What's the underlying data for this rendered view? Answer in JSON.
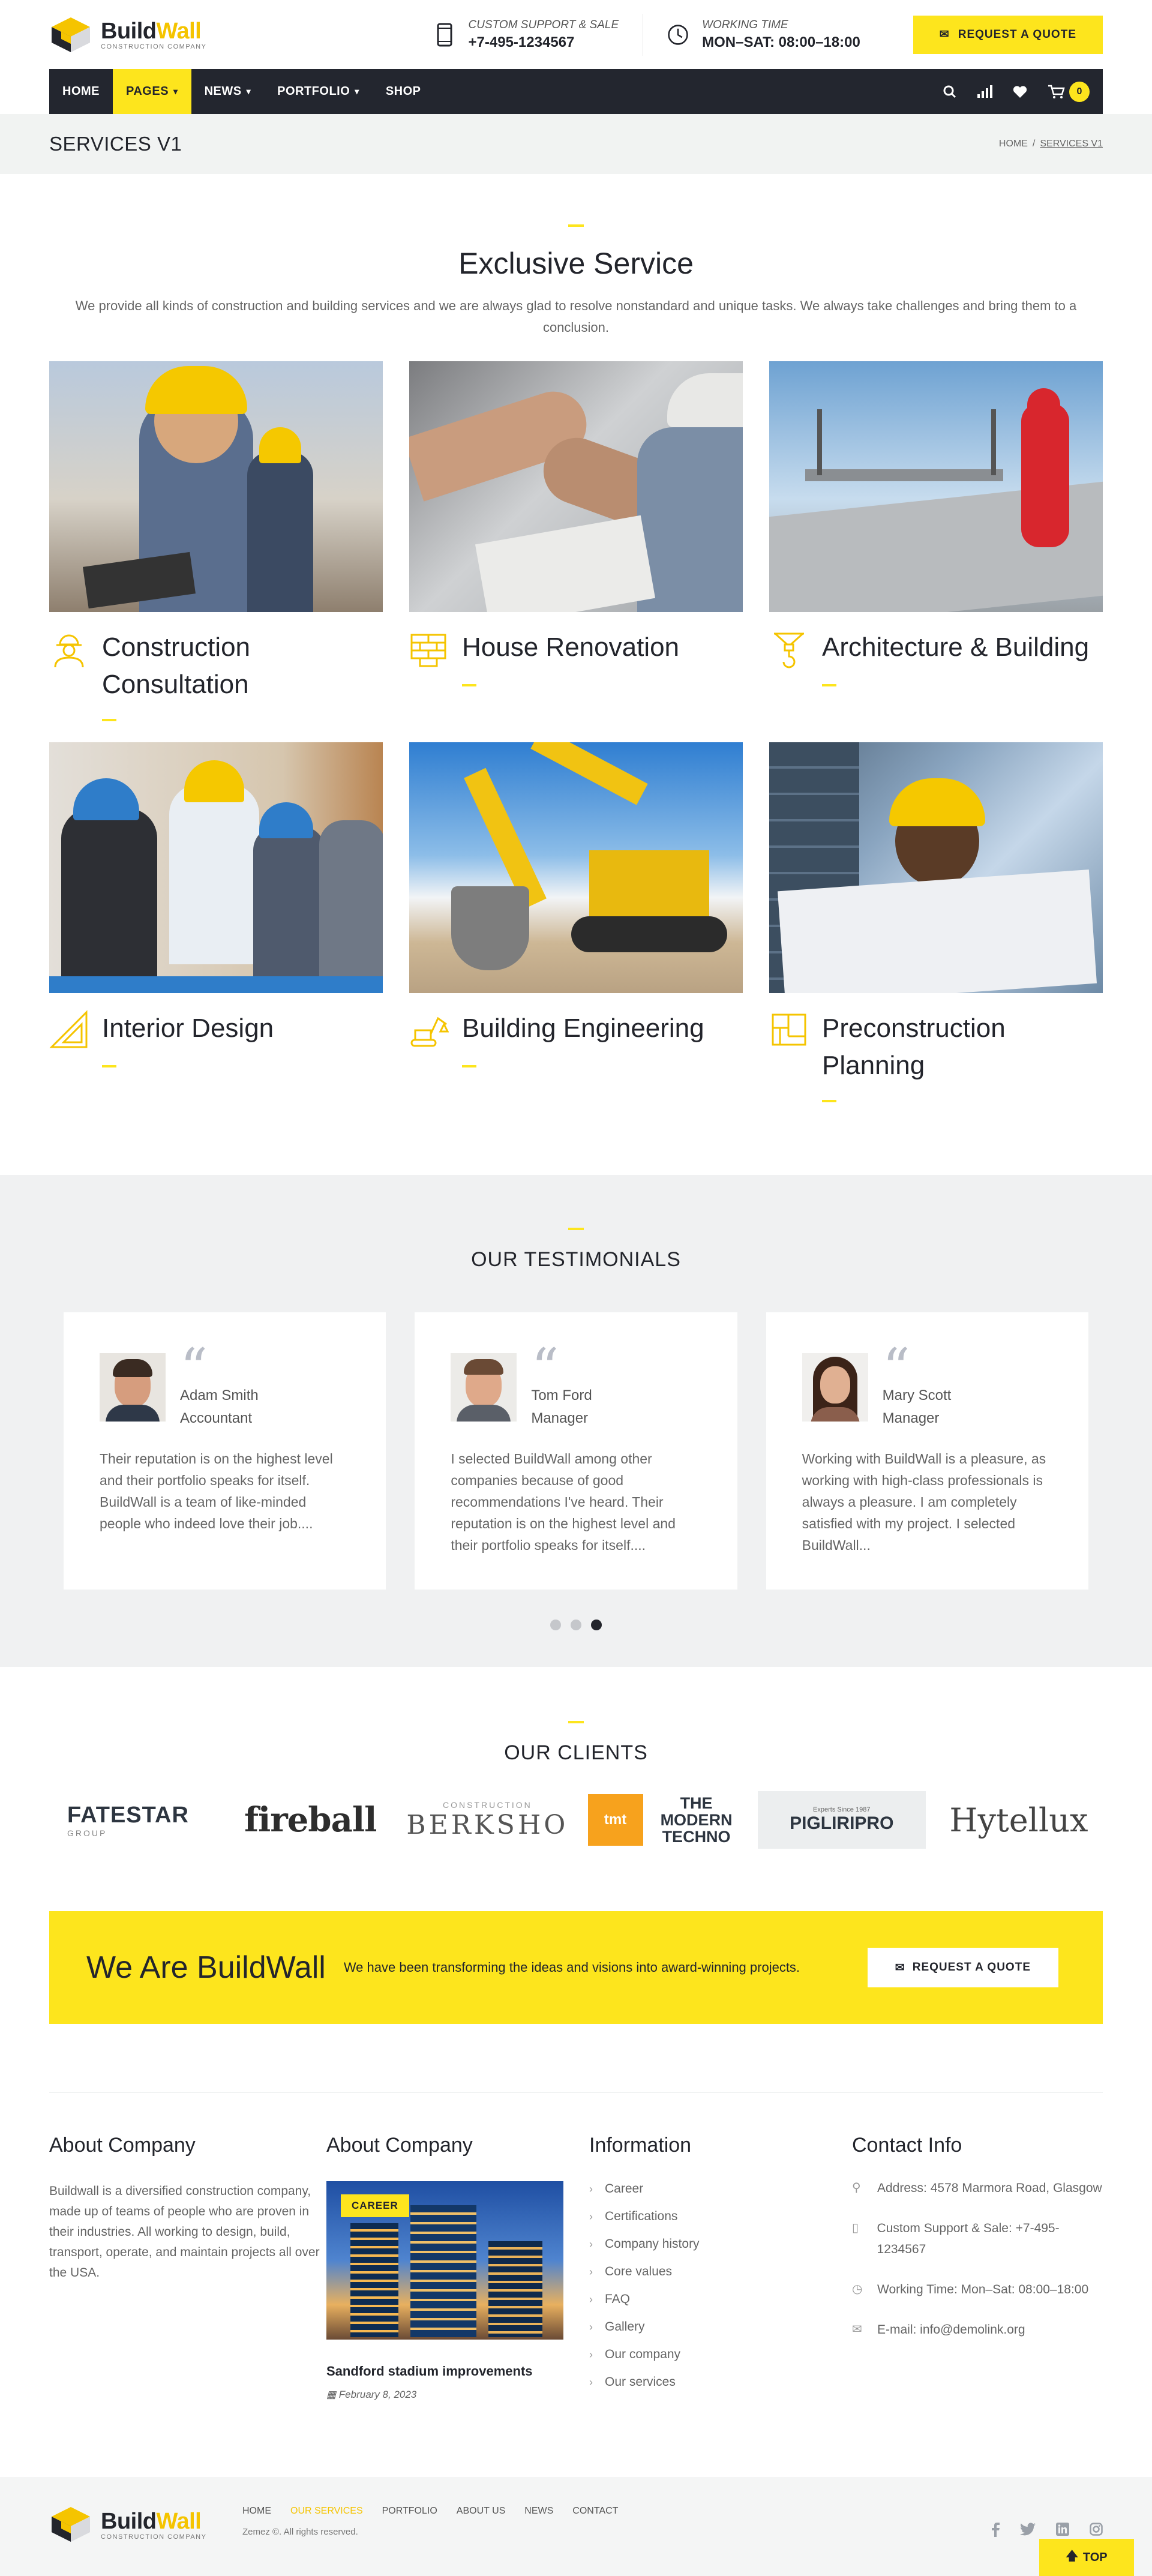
{
  "brand": {
    "name_a": "Build",
    "name_b": "Wall",
    "tagline": "CONSTRUCTION COMPANY"
  },
  "header": {
    "support_label": "CUSTOM SUPPORT & SALE",
    "support_value": "+7-495-1234567",
    "hours_label": "WORKING TIME",
    "hours_value": "MON–SAT: 08:00–18:00",
    "quote_button": "REQUEST A QUOTE"
  },
  "nav": {
    "items": [
      {
        "label": "HOME"
      },
      {
        "label": "PAGES"
      },
      {
        "label": "NEWS"
      },
      {
        "label": "PORTFOLIO"
      },
      {
        "label": "SHOP"
      }
    ],
    "cart_count": "0"
  },
  "breadcrumb": {
    "title": "SERVICES V1",
    "home": "HOME",
    "sep": "/",
    "current": "SERVICES V1"
  },
  "services": {
    "title": "Exclusive Service",
    "description": "We provide all kinds of construction and building services and we are always glad to resolve nonstandard and unique tasks. We always take challenges and bring them to a conclusion.",
    "items": [
      {
        "title": "Construction Consultation",
        "icon": "worker-icon"
      },
      {
        "title": "House Renovation",
        "icon": "bricks-icon"
      },
      {
        "title": "Architecture & Building",
        "icon": "crane-hook-icon"
      },
      {
        "title": "Interior Design",
        "icon": "ruler-triangle-icon"
      },
      {
        "title": "Building Engineering",
        "icon": "excavator-icon"
      },
      {
        "title": "Preconstruction Planning",
        "icon": "blueprint-icon"
      }
    ]
  },
  "testimonials": {
    "title": "OUR TESTIMONIALS",
    "items": [
      {
        "name": "Adam Smith",
        "role": "Accountant",
        "text": "Their reputation is on the highest level and their portfolio speaks for itself. BuildWall is a team of like-minded people who indeed love their job...."
      },
      {
        "name": "Tom Ford",
        "role": "Manager",
        "text": "I selected BuildWall among other companies because of good recommendations I've heard. Their reputation is on the highest level and their portfolio speaks for itself...."
      },
      {
        "name": "Mary Scott",
        "role": "Manager",
        "text": "Working with BuildWall is a pleasure, as working with high-class professionals is always a pleasure. I am completely satisfied with my project. I selected BuildWall..."
      }
    ],
    "active_dot": 3
  },
  "clients": {
    "title": "OUR CLIENTS",
    "logos": [
      {
        "main": "FATESTAR",
        "sub": "GROUP"
      },
      {
        "main": "fireball"
      },
      {
        "main": "BERKSHO",
        "sub": "CONSTRUCTION"
      },
      {
        "main": "THE MODERN TECHNO",
        "badge": "tmt"
      },
      {
        "main": "PIGLIRIPRO",
        "sub": "Experts Since 1987"
      },
      {
        "main": "Hytellux"
      }
    ]
  },
  "cta": {
    "title": "We Are BuildWall",
    "text": "We have been transforming the ideas and visions into award-winning projects.",
    "button": "REQUEST A QUOTE"
  },
  "footer": {
    "about_title": "About Company",
    "about_text": "Buildwall is a diversified construction company, made up of teams of people who are proven in their industries. All working to design, build, transport, operate, and maintain projects all over the USA.",
    "post_title_heading": "About Company",
    "post_tag": "CAREER",
    "post_title": "Sandford stadium improvements",
    "post_date": "February 8, 2023",
    "info_title": "Information",
    "info_links": [
      "Career",
      "Certifications",
      "Company history",
      "Core values",
      "FAQ",
      "Gallery",
      "Our company",
      "Our services"
    ],
    "contact_title": "Contact Info",
    "address": "Address: 4578 Marmora Road, Glasgow",
    "support": "Custom Support & Sale: +7-495-1234567",
    "hours": "Working Time: Mon–Sat: 08:00–18:00",
    "email": "E-mail: info@demolink.org"
  },
  "bottom": {
    "links": [
      "HOME",
      "OUR SERVICES",
      "PORTFOLIO",
      "ABOUT US",
      "NEWS",
      "CONTACT"
    ],
    "copyright": "Zemez ©. All rights reserved.",
    "top_button": "TOP"
  }
}
